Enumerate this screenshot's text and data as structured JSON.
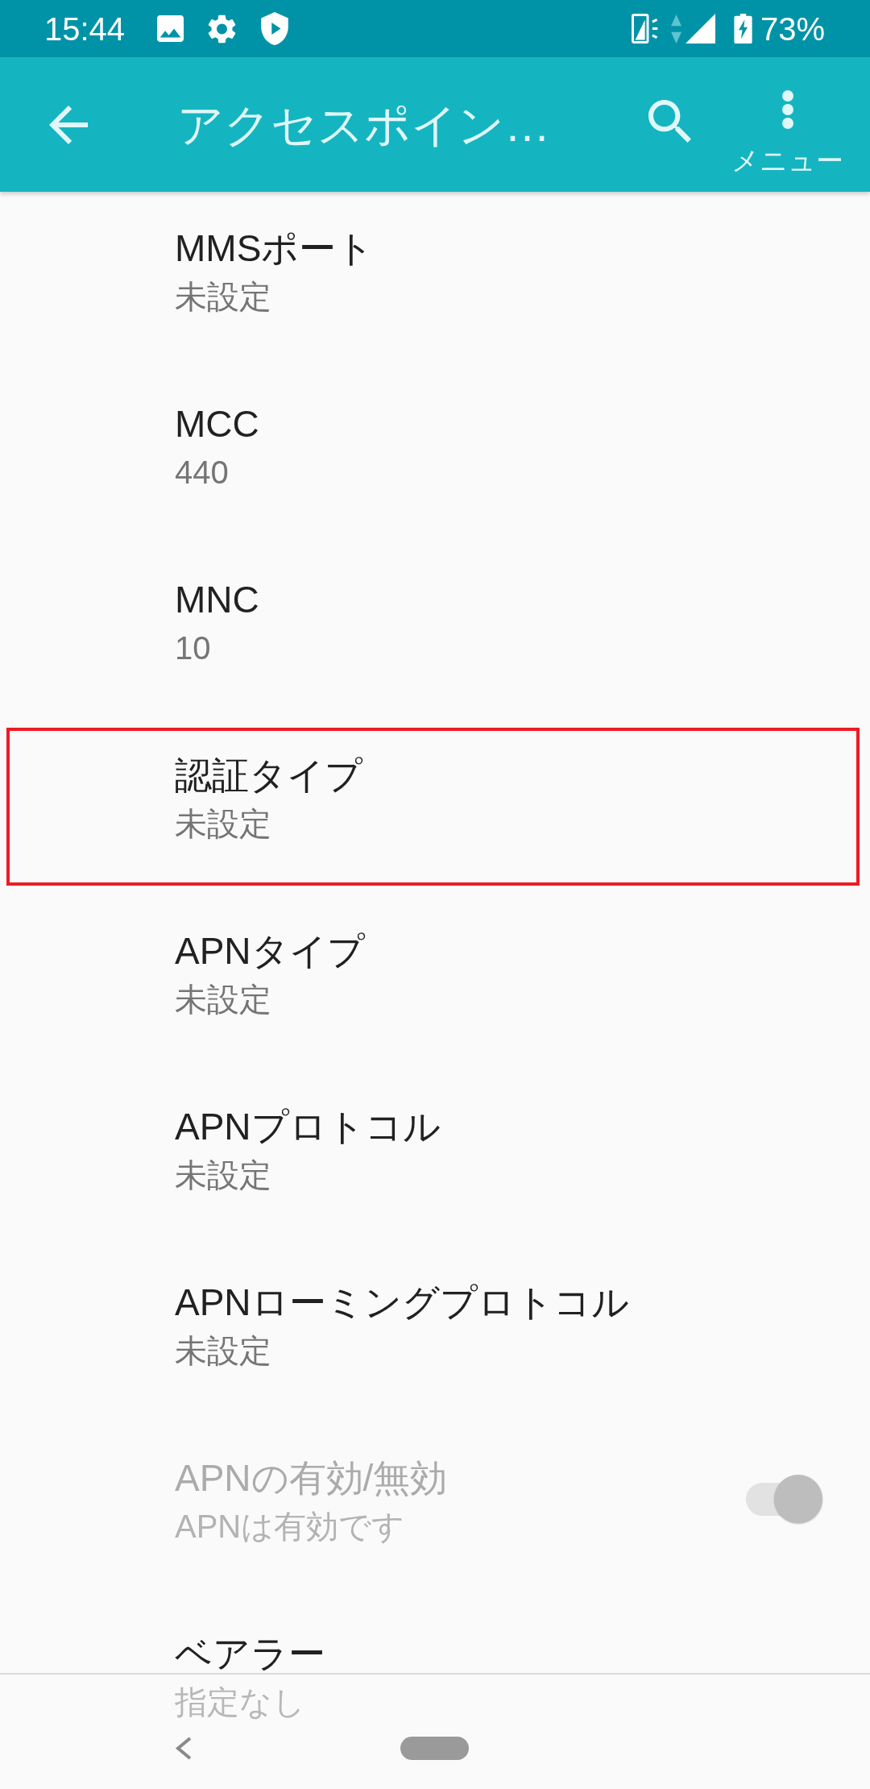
{
  "status_bar": {
    "time": "15:44",
    "battery": "73%"
  },
  "app_bar": {
    "title": "アクセスポイン…",
    "menu_label": "メニュー"
  },
  "settings": [
    {
      "kind": "text",
      "title": "MMSポート",
      "summary": "未設定",
      "disabled": false,
      "highlighted": false
    },
    {
      "kind": "text",
      "title": "MCC",
      "summary": "440",
      "disabled": false,
      "highlighted": false
    },
    {
      "kind": "text",
      "title": "MNC",
      "summary": "10",
      "disabled": false,
      "highlighted": false
    },
    {
      "kind": "text",
      "title": "認証タイプ",
      "summary": "未設定",
      "disabled": false,
      "highlighted": true
    },
    {
      "kind": "text",
      "title": "APNタイプ",
      "summary": "未設定",
      "disabled": false,
      "highlighted": false
    },
    {
      "kind": "text",
      "title": "APNプロトコル",
      "summary": "未設定",
      "disabled": false,
      "highlighted": false
    },
    {
      "kind": "text",
      "title": "APNローミングプロトコル",
      "summary": "未設定",
      "disabled": false,
      "highlighted": false
    },
    {
      "kind": "switch",
      "title": "APNの有効/無効",
      "summary": "APNは有効です",
      "disabled": true,
      "checked": true,
      "highlighted": false
    },
    {
      "kind": "text",
      "title": "ベアラー",
      "summary": "指定なし",
      "disabled": false,
      "highlighted": false
    }
  ]
}
